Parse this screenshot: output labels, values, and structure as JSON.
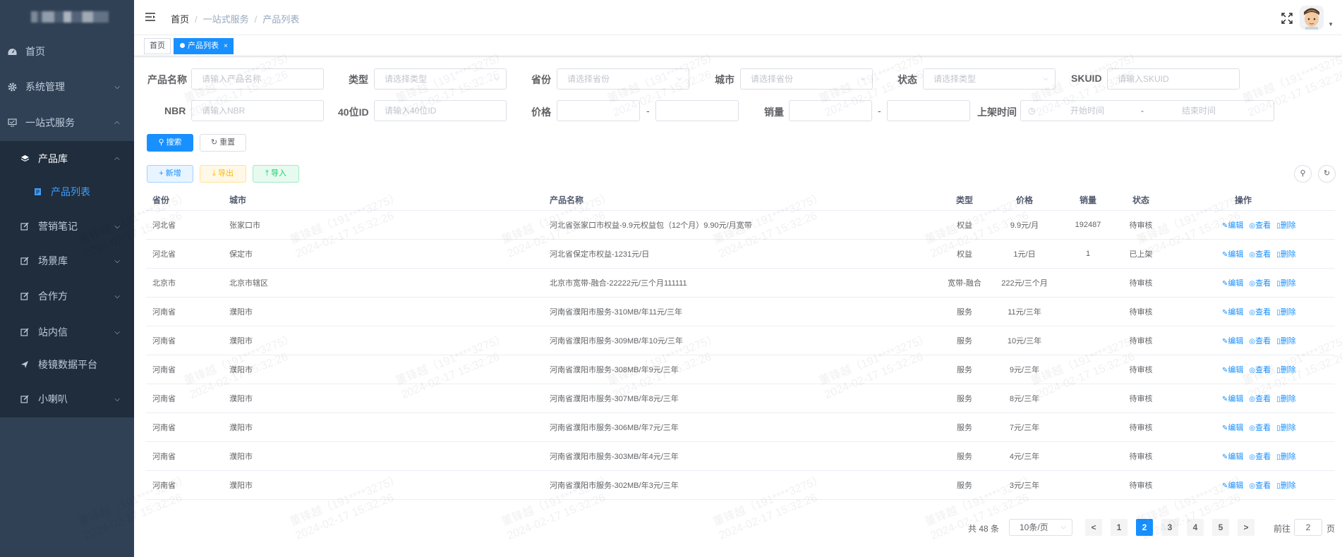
{
  "sidebar": {
    "items": [
      {
        "label": "首页",
        "icon": "dashboard-icon"
      },
      {
        "label": "系统管理",
        "icon": "gear-icon"
      },
      {
        "label": "一站式服务",
        "icon": "monitor-icon"
      },
      {
        "label": "产品库",
        "icon": "layers-icon"
      },
      {
        "label": "产品列表",
        "icon": "document-icon"
      },
      {
        "label": "营销笔记",
        "icon": "edit-icon"
      },
      {
        "label": "场景库",
        "icon": "edit-icon"
      },
      {
        "label": "合作方",
        "icon": "edit-icon"
      },
      {
        "label": "站内信",
        "icon": "edit-icon"
      },
      {
        "label": "棱镜数据平台",
        "icon": "send-icon"
      },
      {
        "label": "小喇叭",
        "icon": "edit-icon"
      }
    ]
  },
  "breadcrumb": {
    "home": "首页",
    "level1": "一站式服务",
    "level2": "产品列表",
    "sep": "/"
  },
  "tags": {
    "home": "首页",
    "active": "产品列表",
    "close": "×"
  },
  "form": {
    "product_name_label": "产品名称",
    "product_name_placeholder": "请输入产品名称",
    "type_label": "类型",
    "type_placeholder": "请选择类型",
    "province_label": "省份",
    "province_placeholder": "请选择省份",
    "city_label": "城市",
    "city_placeholder": "请选择省份",
    "status_label": "状态",
    "status_placeholder": "请选择类型",
    "skuid_label": "SKUID",
    "skuid_placeholder": "请输入SKUID",
    "nbr_label": "NBR",
    "nbr_placeholder": "请输入NBR",
    "id40_label": "40位ID",
    "id40_placeholder": "请输入40位ID",
    "price_label": "价格",
    "sales_label": "销量",
    "listed_time_label": "上架时间",
    "start_placeholder": "开始时间",
    "end_placeholder": "结束时间",
    "dash": "-"
  },
  "buttons": {
    "search": "搜索",
    "reset": "重置",
    "add": "新增",
    "export": "导出",
    "import": "导入"
  },
  "table": {
    "headers": [
      "省份",
      "城市",
      "产品名称",
      "类型",
      "价格",
      "销量",
      "状态",
      "操作"
    ],
    "ops": {
      "edit": "编辑",
      "view": "查看",
      "delete": "删除"
    },
    "rows": [
      [
        "河北省",
        "张家口市",
        "河北省张家口市权益-9.9元权益包（12个月）9.90元/月宽带",
        "权益",
        "9.9元/月",
        "192487",
        "待审核"
      ],
      [
        "河北省",
        "保定市",
        "河北省保定市权益-1231元/日",
        "权益",
        "1元/日",
        "1",
        "已上架"
      ],
      [
        "北京市",
        "北京市辖区",
        "北京市宽带-融合-22222元/三个月111111",
        "宽带-融合",
        "222元/三个月",
        "",
        "待审核"
      ],
      [
        "河南省",
        "濮阳市",
        "河南省濮阳市服务-310MB/年11元/三年",
        "服务",
        "11元/三年",
        "",
        "待审核"
      ],
      [
        "河南省",
        "濮阳市",
        "河南省濮阳市服务-309MB/年10元/三年",
        "服务",
        "10元/三年",
        "",
        "待审核"
      ],
      [
        "河南省",
        "濮阳市",
        "河南省濮阳市服务-308MB/年9元/三年",
        "服务",
        "9元/三年",
        "",
        "待审核"
      ],
      [
        "河南省",
        "濮阳市",
        "河南省濮阳市服务-307MB/年8元/三年",
        "服务",
        "8元/三年",
        "",
        "待审核"
      ],
      [
        "河南省",
        "濮阳市",
        "河南省濮阳市服务-306MB/年7元/三年",
        "服务",
        "7元/三年",
        "",
        "待审核"
      ],
      [
        "河南省",
        "濮阳市",
        "河南省濮阳市服务-303MB/年4元/三年",
        "服务",
        "4元/三年",
        "",
        "待审核"
      ],
      [
        "河南省",
        "濮阳市",
        "河南省濮阳市服务-302MB/年3元/三年",
        "服务",
        "3元/三年",
        "",
        "待审核"
      ]
    ]
  },
  "pagination": {
    "total": "共 48 条",
    "page_size": "10条/页",
    "pages": [
      "1",
      "2",
      "3",
      "4",
      "5"
    ],
    "current": "2",
    "goto_label": "前往",
    "goto_value": "2",
    "page_suffix": "页",
    "prev": "<",
    "next": ">"
  },
  "watermark": {
    "line1": "董锋越（191****3275）",
    "line2": "2024-02-17 15:32:26"
  },
  "colors": {
    "sidebar_bg": "#304156",
    "submenu_bg": "#1f2d3d",
    "primary": "#1890ff",
    "menu_text": "#bfcbd9"
  }
}
